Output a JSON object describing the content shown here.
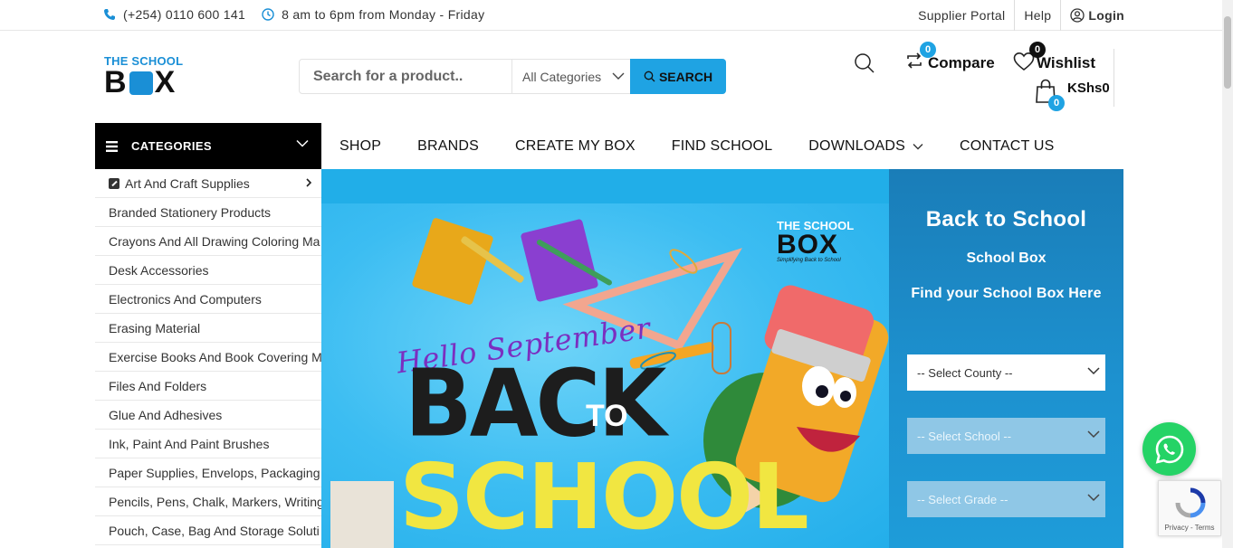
{
  "topbar": {
    "phone": "(+254) 0110 600 141",
    "hours": "8 am to 6pm from Monday - Friday",
    "links": [
      "Supplier Portal",
      "Help"
    ],
    "login": "Login"
  },
  "logo": {
    "line1": "THE SCHOOL",
    "line2_a": "B",
    "line2_b": "X"
  },
  "search": {
    "placeholder": "Search for a product..",
    "category": "All Categories",
    "button": "SEARCH"
  },
  "header": {
    "compare_label": "Compare",
    "compare_count": "0",
    "wishlist_label": "Wishlist",
    "wishlist_count": "0",
    "cart_total": "KShs0",
    "cart_count": "0"
  },
  "categories_label": "CATEGORIES",
  "nav": [
    "SHOP",
    "BRANDS",
    "CREATE MY BOX",
    "FIND SCHOOL",
    "DOWNLOADS",
    "CONTACT US"
  ],
  "side_categories": [
    "Art And Craft Supplies",
    "Branded Stationery Products",
    "Crayons And All Drawing Coloring Ma",
    "Desk Accessories",
    "Electronics And Computers",
    "Erasing Material",
    "Exercise Books And Book Covering M",
    "Files And Folders",
    "Glue And Adhesives",
    "Ink, Paint And Paint Brushes",
    "Paper Supplies, Envelops, Packaging",
    "Pencils, Pens, Chalk, Markers, Writing",
    "Pouch, Case, Bag And Storage Soluti"
  ],
  "hero": {
    "hello": "Hello September",
    "back": "BACK",
    "to": "TO",
    "school": "SCHOOL",
    "mini_logo_a": "THE SCHOOL",
    "mini_logo_b": "BOX",
    "mini_logo_c": "Simplifying Back to School"
  },
  "finder": {
    "title": "Back to School",
    "subtitle": "School Box",
    "find": "Find your School Box Here",
    "county": "-- Select County --",
    "school": "-- Select School --",
    "grade": "-- Select Grade --"
  },
  "recaptcha": "Privacy - Terms",
  "colors": {
    "accent": "#1fa3e3",
    "whatsapp": "#25d366",
    "dark": "#000000"
  }
}
